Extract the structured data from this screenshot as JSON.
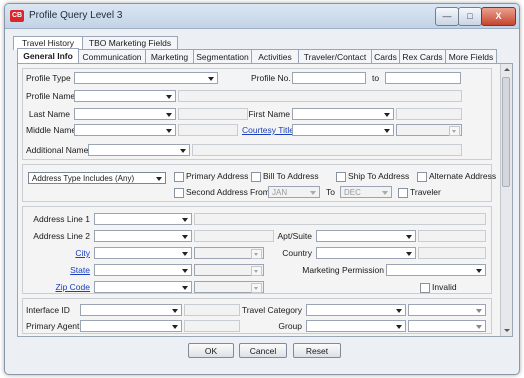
{
  "window": {
    "title": "Profile Query Level 3",
    "app_icon": "CB",
    "minimize": "—",
    "maximize": "□",
    "close": "X"
  },
  "outer_tabs": [
    "Travel History",
    "TBO Marketing Fields"
  ],
  "inner_tabs": [
    "General Info",
    "Communication",
    "Marketing",
    "Segmentation",
    "Activities",
    "Traveler/Contact",
    "Cards",
    "Rex Cards",
    "More Fields"
  ],
  "form": {
    "profile_type": "Profile Type",
    "profile_no": "Profile No.",
    "to": "to",
    "profile_name": "Profile Name",
    "last_name": "Last Name",
    "first_name": "First Name",
    "middle_name": "Middle Name",
    "courtesy_title": "Courtesy Title",
    "additional_name": "Additional Name"
  },
  "address_filter": {
    "type": "Address Type Includes (Any)",
    "primary_address": "Primary Address",
    "bill_to": "Bill To Address",
    "ship_to": "Ship To Address",
    "alternate": "Alternate Address",
    "second": "Second Address",
    "from": "From",
    "from_value": "JAN",
    "to": "To",
    "to_value": "DEC",
    "traveler": "Traveler"
  },
  "address": {
    "line1": "Address Line 1",
    "line2": "Address Line 2",
    "apt_suite": "Apt/Suite",
    "city": "City",
    "country": "Country",
    "state": "State",
    "marketing_permission": "Marketing Permission",
    "zip": "Zip Code",
    "invalid": "Invalid"
  },
  "other": {
    "interface_id": "Interface ID",
    "travel_category": "Travel Category",
    "primary_agent": "Primary Agent",
    "group": "Group"
  },
  "buttons": {
    "ok": "OK",
    "cancel": "Cancel",
    "reset": "Reset"
  }
}
